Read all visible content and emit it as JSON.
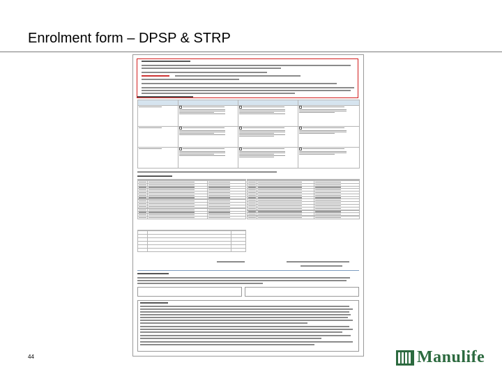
{
  "slide": {
    "title": "Enrolment form – DPSP & STRP",
    "page_number": "44"
  },
  "logo": {
    "text": "Manulife",
    "color": "#2c6a3f",
    "icon": "manulife-logo-icon"
  },
  "document": {
    "highlight_color": "#d21b1b"
  }
}
